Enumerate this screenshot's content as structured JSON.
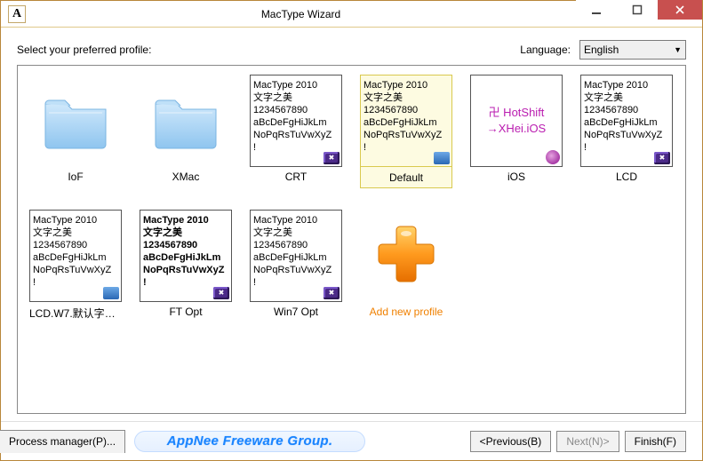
{
  "window": {
    "title": "MacType Wizard"
  },
  "labels": {
    "select_profile": "Select your preferred profile:",
    "language": "Language:"
  },
  "language": {
    "selected": "English",
    "options": [
      "English"
    ]
  },
  "sample_text": {
    "l1": "MacType 2010",
    "l2": "文字之美",
    "l3": "1234567890",
    "l4": "aBcDeFgHiJkLm",
    "l5": "NoPqRsTuVwXyZ",
    "l6": "!"
  },
  "ios_text": {
    "l1": "卍 HotShift",
    "l2": "→XHei.iOS"
  },
  "tiles": [
    {
      "id": "iof",
      "label": "IoF",
      "kind": "folder"
    },
    {
      "id": "xmac",
      "label": "XMac",
      "kind": "folder"
    },
    {
      "id": "crt",
      "label": "CRT",
      "kind": "sample",
      "badge": "purple"
    },
    {
      "id": "default",
      "label": "Default",
      "kind": "sample",
      "badge": "blue",
      "selected": true
    },
    {
      "id": "ios",
      "label": "iOS",
      "kind": "ios",
      "badge": "swirl"
    },
    {
      "id": "lcd",
      "label": "LCD",
      "kind": "sample",
      "badge": "purple"
    },
    {
      "id": "lcdw7",
      "label": "LCD.W7.默认字体...",
      "kind": "sample",
      "badge": "blue"
    },
    {
      "id": "ftopt",
      "label": "FT Opt",
      "kind": "sample",
      "badge": "purple",
      "bold": true
    },
    {
      "id": "win7opt",
      "label": "Win7 Opt",
      "kind": "sample",
      "badge": "purple"
    },
    {
      "id": "addnew",
      "label": "Add new profile",
      "kind": "add"
    }
  ],
  "footer": {
    "process_manager": "Process manager(P)...",
    "appnee": "AppNee Freeware Group.",
    "previous": "<Previous(B)",
    "next": "Next(N)>",
    "finish": "Finish(F)"
  }
}
